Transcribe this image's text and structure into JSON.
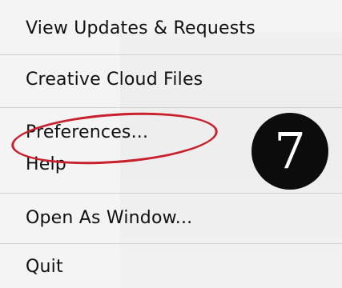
{
  "menu": {
    "items": [
      {
        "label": "View Updates & Requests"
      },
      {
        "label": "Creative Cloud Files"
      },
      {
        "label": "Preferences..."
      },
      {
        "label": "Help"
      },
      {
        "label": "Open As Window..."
      },
      {
        "label": "Quit"
      }
    ]
  },
  "annotation": {
    "step_number": "7",
    "highlight_color": "#c8202c"
  }
}
